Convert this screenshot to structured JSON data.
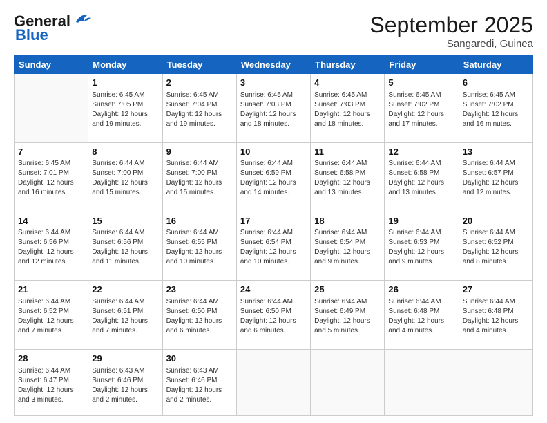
{
  "header": {
    "logo_general": "General",
    "logo_blue": "Blue",
    "month_title": "September 2025",
    "location": "Sangaredi, Guinea"
  },
  "days_of_week": [
    "Sunday",
    "Monday",
    "Tuesday",
    "Wednesday",
    "Thursday",
    "Friday",
    "Saturday"
  ],
  "weeks": [
    [
      {
        "day": "",
        "info": ""
      },
      {
        "day": "1",
        "info": "Sunrise: 6:45 AM\nSunset: 7:05 PM\nDaylight: 12 hours\nand 19 minutes."
      },
      {
        "day": "2",
        "info": "Sunrise: 6:45 AM\nSunset: 7:04 PM\nDaylight: 12 hours\nand 19 minutes."
      },
      {
        "day": "3",
        "info": "Sunrise: 6:45 AM\nSunset: 7:03 PM\nDaylight: 12 hours\nand 18 minutes."
      },
      {
        "day": "4",
        "info": "Sunrise: 6:45 AM\nSunset: 7:03 PM\nDaylight: 12 hours\nand 18 minutes."
      },
      {
        "day": "5",
        "info": "Sunrise: 6:45 AM\nSunset: 7:02 PM\nDaylight: 12 hours\nand 17 minutes."
      },
      {
        "day": "6",
        "info": "Sunrise: 6:45 AM\nSunset: 7:02 PM\nDaylight: 12 hours\nand 16 minutes."
      }
    ],
    [
      {
        "day": "7",
        "info": "Sunrise: 6:45 AM\nSunset: 7:01 PM\nDaylight: 12 hours\nand 16 minutes."
      },
      {
        "day": "8",
        "info": "Sunrise: 6:44 AM\nSunset: 7:00 PM\nDaylight: 12 hours\nand 15 minutes."
      },
      {
        "day": "9",
        "info": "Sunrise: 6:44 AM\nSunset: 7:00 PM\nDaylight: 12 hours\nand 15 minutes."
      },
      {
        "day": "10",
        "info": "Sunrise: 6:44 AM\nSunset: 6:59 PM\nDaylight: 12 hours\nand 14 minutes."
      },
      {
        "day": "11",
        "info": "Sunrise: 6:44 AM\nSunset: 6:58 PM\nDaylight: 12 hours\nand 13 minutes."
      },
      {
        "day": "12",
        "info": "Sunrise: 6:44 AM\nSunset: 6:58 PM\nDaylight: 12 hours\nand 13 minutes."
      },
      {
        "day": "13",
        "info": "Sunrise: 6:44 AM\nSunset: 6:57 PM\nDaylight: 12 hours\nand 12 minutes."
      }
    ],
    [
      {
        "day": "14",
        "info": "Sunrise: 6:44 AM\nSunset: 6:56 PM\nDaylight: 12 hours\nand 12 minutes."
      },
      {
        "day": "15",
        "info": "Sunrise: 6:44 AM\nSunset: 6:56 PM\nDaylight: 12 hours\nand 11 minutes."
      },
      {
        "day": "16",
        "info": "Sunrise: 6:44 AM\nSunset: 6:55 PM\nDaylight: 12 hours\nand 10 minutes."
      },
      {
        "day": "17",
        "info": "Sunrise: 6:44 AM\nSunset: 6:54 PM\nDaylight: 12 hours\nand 10 minutes."
      },
      {
        "day": "18",
        "info": "Sunrise: 6:44 AM\nSunset: 6:54 PM\nDaylight: 12 hours\nand 9 minutes."
      },
      {
        "day": "19",
        "info": "Sunrise: 6:44 AM\nSunset: 6:53 PM\nDaylight: 12 hours\nand 9 minutes."
      },
      {
        "day": "20",
        "info": "Sunrise: 6:44 AM\nSunset: 6:52 PM\nDaylight: 12 hours\nand 8 minutes."
      }
    ],
    [
      {
        "day": "21",
        "info": "Sunrise: 6:44 AM\nSunset: 6:52 PM\nDaylight: 12 hours\nand 7 minutes."
      },
      {
        "day": "22",
        "info": "Sunrise: 6:44 AM\nSunset: 6:51 PM\nDaylight: 12 hours\nand 7 minutes."
      },
      {
        "day": "23",
        "info": "Sunrise: 6:44 AM\nSunset: 6:50 PM\nDaylight: 12 hours\nand 6 minutes."
      },
      {
        "day": "24",
        "info": "Sunrise: 6:44 AM\nSunset: 6:50 PM\nDaylight: 12 hours\nand 6 minutes."
      },
      {
        "day": "25",
        "info": "Sunrise: 6:44 AM\nSunset: 6:49 PM\nDaylight: 12 hours\nand 5 minutes."
      },
      {
        "day": "26",
        "info": "Sunrise: 6:44 AM\nSunset: 6:48 PM\nDaylight: 12 hours\nand 4 minutes."
      },
      {
        "day": "27",
        "info": "Sunrise: 6:44 AM\nSunset: 6:48 PM\nDaylight: 12 hours\nand 4 minutes."
      }
    ],
    [
      {
        "day": "28",
        "info": "Sunrise: 6:44 AM\nSunset: 6:47 PM\nDaylight: 12 hours\nand 3 minutes."
      },
      {
        "day": "29",
        "info": "Sunrise: 6:43 AM\nSunset: 6:46 PM\nDaylight: 12 hours\nand 2 minutes."
      },
      {
        "day": "30",
        "info": "Sunrise: 6:43 AM\nSunset: 6:46 PM\nDaylight: 12 hours\nand 2 minutes."
      },
      {
        "day": "",
        "info": ""
      },
      {
        "day": "",
        "info": ""
      },
      {
        "day": "",
        "info": ""
      },
      {
        "day": "",
        "info": ""
      }
    ]
  ]
}
